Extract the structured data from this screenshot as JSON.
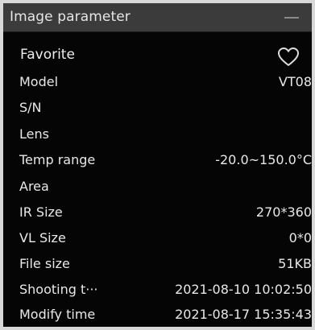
{
  "panel": {
    "title": "Image parameter",
    "favorite_label": "Favorite",
    "favorite_icon": "heart-outline-icon",
    "collapse_icon": "minus-icon"
  },
  "params": [
    {
      "label": "Model",
      "value": "VT08"
    },
    {
      "label": "S/N",
      "value": ""
    },
    {
      "label": "Lens",
      "value": ""
    },
    {
      "label": "Temp range",
      "value": "-20.0~150.0°C"
    },
    {
      "label": "Area",
      "value": ""
    },
    {
      "label": "IR Size",
      "value": "270*360"
    },
    {
      "label": "VL Size",
      "value": "0*0"
    },
    {
      "label": "File size",
      "value": "51KB"
    },
    {
      "label": "Shooting t···",
      "value": "2021-08-10 10:02:50"
    },
    {
      "label": "Modify time",
      "value": "2021-08-17 15:35:43"
    }
  ]
}
